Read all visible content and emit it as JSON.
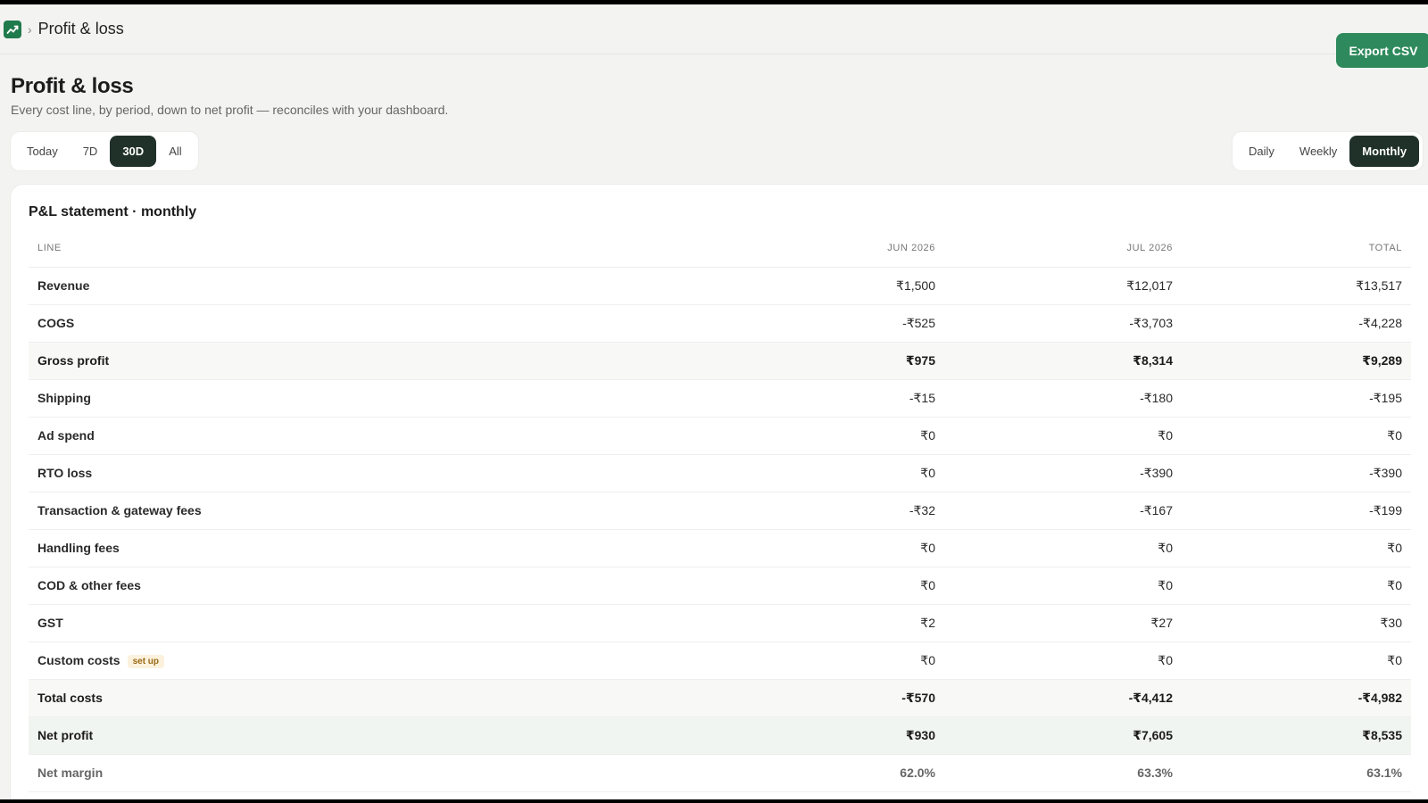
{
  "breadcrumb": {
    "separator": "›",
    "title": "Profit & loss"
  },
  "header": {
    "title": "Profit & loss",
    "subtitle": "Every cost line, by period, down to net profit — reconciles with your dashboard.",
    "export_label": "Export CSV"
  },
  "range_options": [
    {
      "label": "Today",
      "active": false
    },
    {
      "label": "7D",
      "active": false
    },
    {
      "label": "30D",
      "active": true
    },
    {
      "label": "All",
      "active": false
    }
  ],
  "granularity_options": [
    {
      "label": "Daily",
      "active": false
    },
    {
      "label": "Weekly",
      "active": false
    },
    {
      "label": "Monthly",
      "active": true
    }
  ],
  "statement": {
    "title": "P&L statement · monthly",
    "columns": [
      "LINE",
      "JUN 2026",
      "JUL 2026",
      "TOTAL"
    ],
    "rows": [
      {
        "line": "Revenue",
        "jun": "₹1,500",
        "jul": "₹12,017",
        "total": "₹13,517",
        "kind": "normal"
      },
      {
        "line": "COGS",
        "jun": "-₹525",
        "jul": "-₹3,703",
        "total": "-₹4,228",
        "kind": "normal"
      },
      {
        "line": "Gross profit",
        "jun": "₹975",
        "jul": "₹8,314",
        "total": "₹9,289",
        "kind": "sub"
      },
      {
        "line": "Shipping",
        "jun": "-₹15",
        "jul": "-₹180",
        "total": "-₹195",
        "kind": "normal"
      },
      {
        "line": "Ad spend",
        "jun": "₹0",
        "jul": "₹0",
        "total": "₹0",
        "kind": "normal"
      },
      {
        "line": "RTO loss",
        "jun": "₹0",
        "jul": "-₹390",
        "total": "-₹390",
        "kind": "normal"
      },
      {
        "line": "Transaction & gateway fees",
        "jun": "-₹32",
        "jul": "-₹167",
        "total": "-₹199",
        "kind": "normal"
      },
      {
        "line": "Handling fees",
        "jun": "₹0",
        "jul": "₹0",
        "total": "₹0",
        "kind": "normal"
      },
      {
        "line": "COD & other fees",
        "jun": "₹0",
        "jul": "₹0",
        "total": "₹0",
        "kind": "normal"
      },
      {
        "line": "GST",
        "jun": "₹2",
        "jul": "₹27",
        "total": "₹30",
        "kind": "normal"
      },
      {
        "line": "Custom costs",
        "badge": "set up",
        "jun": "₹0",
        "jul": "₹0",
        "total": "₹0",
        "kind": "normal"
      },
      {
        "line": "Total costs",
        "jun": "-₹570",
        "jul": "-₹4,412",
        "total": "-₹4,982",
        "kind": "sub"
      },
      {
        "line": "Net profit",
        "jun": "₹930",
        "jul": "₹7,605",
        "total": "₹8,535",
        "kind": "net"
      },
      {
        "line": "Net margin",
        "jun": "62.0%",
        "jul": "63.3%",
        "total": "63.1%",
        "kind": "margin"
      }
    ]
  },
  "colors": {
    "accent": "#2e8a5c",
    "active_segment": "#20312a",
    "logo": "#1f7a4c"
  },
  "icons": {
    "logo": "trend-up-icon"
  }
}
